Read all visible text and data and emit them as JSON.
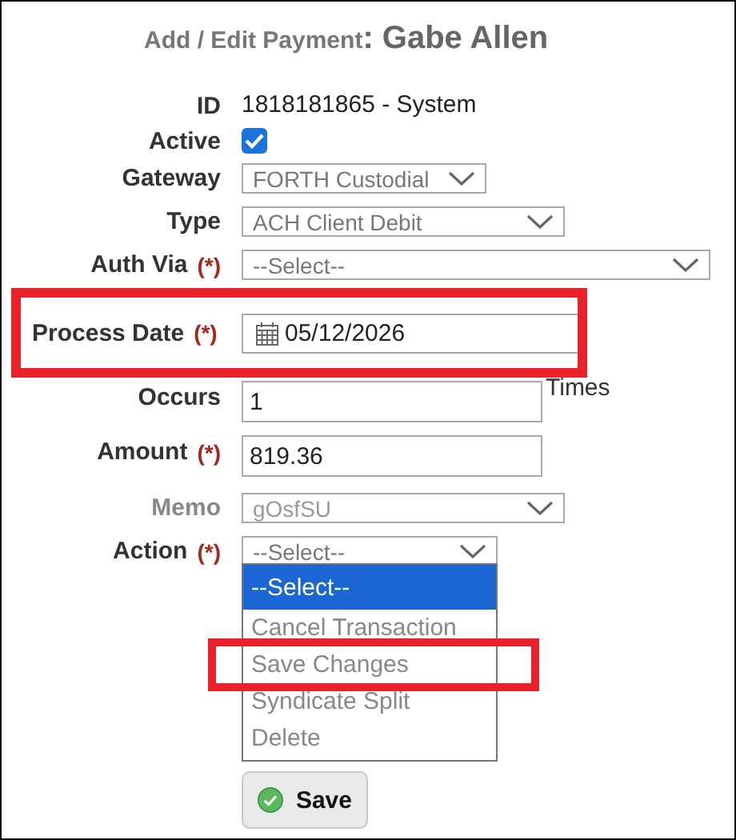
{
  "title": {
    "heading": "Add / Edit Payment",
    "name": ": Gabe Allen"
  },
  "rows": [
    {
      "kind": "text",
      "label": "ID",
      "value": "1818181865 - System",
      "disabled": false
    },
    {
      "kind": "checkbox",
      "label": "Active",
      "checked": true,
      "disabled": false
    },
    {
      "kind": "select",
      "label": "Gateway",
      "value": "FORTH Custodial",
      "disabled": false
    },
    {
      "kind": "select",
      "label": "Type",
      "value": "ACH Client Debit",
      "disabled": false
    },
    {
      "kind": "select",
      "label": "Auth Via",
      "required_mark": "(*)",
      "value": "--Select--",
      "disabled": false
    },
    {
      "kind": "date",
      "label": "Process Date",
      "required_mark": "(*)",
      "value": "05/12/2026",
      "highlighted": true,
      "disabled": false
    },
    {
      "kind": "input",
      "label": "Occurs",
      "value": "1",
      "suffix": "Times",
      "disabled": false
    },
    {
      "kind": "input",
      "label": "Amount",
      "required_mark": "(*)",
      "value": "819.36",
      "disabled": false
    },
    {
      "kind": "select",
      "label": "Memo",
      "value": "gOsfSU",
      "disabled": true
    },
    {
      "kind": "select",
      "label": "Action",
      "required_mark": "(*)",
      "value": "--Select--",
      "disabled": false,
      "open": true,
      "options": [
        {
          "label": "--Select--",
          "selected": true,
          "highlighted": false
        },
        {
          "label": "Cancel Transaction",
          "selected": false,
          "highlighted": false
        },
        {
          "label": "Save Changes",
          "selected": false,
          "highlighted": true
        },
        {
          "label": "Syndicate Split",
          "selected": false,
          "highlighted": false
        },
        {
          "label": "Delete",
          "selected": false,
          "highlighted": false
        }
      ]
    }
  ],
  "save_button": {
    "label": "Save"
  }
}
